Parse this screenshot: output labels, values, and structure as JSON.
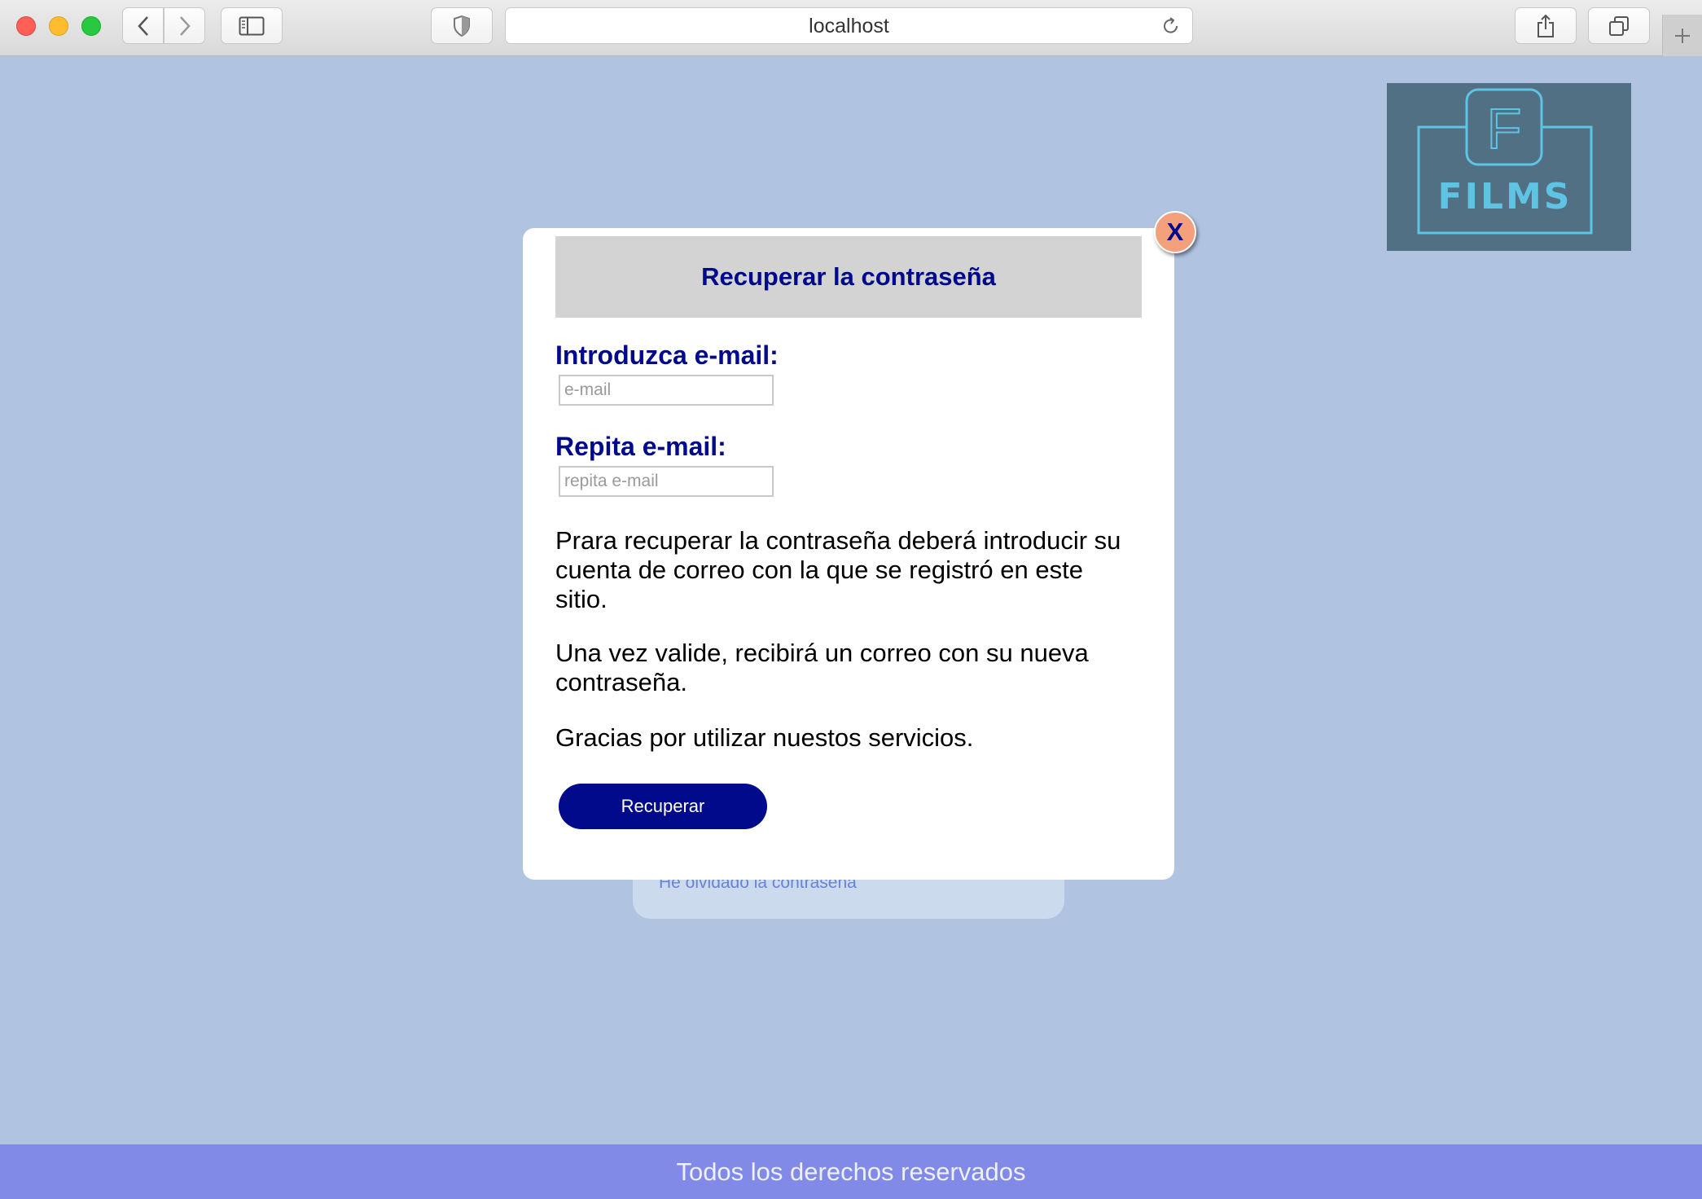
{
  "browser": {
    "url": "localhost"
  },
  "logo": {
    "letter": "F",
    "brand": "FILMS"
  },
  "background_form": {
    "forgot_link": "He olvidado la contraseña"
  },
  "modal": {
    "close_label": "X",
    "title": "Recuperar la contraseña",
    "email_label": "Introduzca e-mail:",
    "email_placeholder": "e-mail",
    "email_value": "",
    "repeat_label": "Repita e-mail:",
    "repeat_placeholder": "repita e-mail",
    "repeat_value": "",
    "paragraphs": [
      "Prara recuperar la contraseña deberá introducir su cuenta de correo con la que se registró en este sitio.",
      "Una vez valide, recibirá un correo con su nueva contraseña.",
      "Gracias por utilizar nuestos servicios."
    ],
    "submit_label": "Recuperar"
  },
  "footer": {
    "text": "Todos los derechos reservados"
  },
  "colors": {
    "page_background": "#b0c4e1",
    "accent": "#000a8a",
    "footer": "#818ae6",
    "close_button": "#f4a07d",
    "logo_background": "#527084",
    "logo_stroke": "#5fc3e4"
  }
}
